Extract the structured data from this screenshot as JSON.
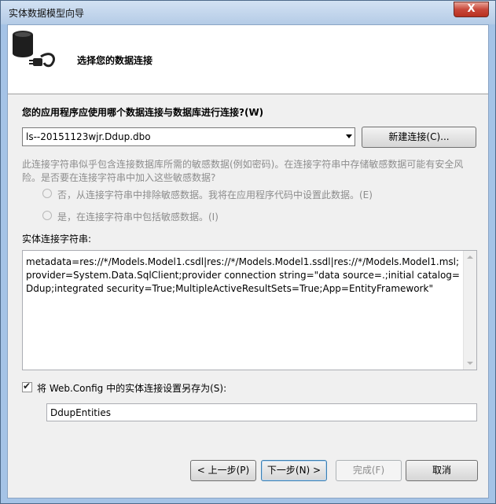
{
  "window": {
    "title": "实体数据模型向导",
    "close_glyph": "X"
  },
  "header": {
    "title": "选择您的数据连接",
    "icon": "database-plug-icon"
  },
  "question": "您的应用程序应使用哪个数据连接与数据库进行连接?(W)",
  "connection": {
    "selected": "ls--20151123wjr.Ddup.dbo",
    "new_button": "新建连接(C)..."
  },
  "sensitive": {
    "line1": "此连接字符串似乎包含连接数据库所需的敏感数据(例如密码)。在连接字符串中存储敏感数据可能有安全风",
    "line2": "险。是否要在连接字符串中加入这些敏感数据?",
    "option_no": "否，从连接字符串中排除敏感数据。我将在应用程序代码中设置此数据。(E)",
    "option_yes": "是，在连接字符串中包括敏感数据。(I)"
  },
  "entity_string": {
    "label": "实体连接字符串:",
    "value": "metadata=res://*/Models.Model1.csdl|res://*/Models.Model1.ssdl|res://*/Models.Model1.msl;provider=System.Data.SqlClient;provider connection string=\"data source=.;initial catalog=Ddup;integrated security=True;MultipleActiveResultSets=True;App=EntityFramework\""
  },
  "save": {
    "checked": true,
    "label": "将 Web.Config 中的实体连接设置另存为(S):",
    "value": "DdupEntities"
  },
  "buttons": {
    "back": "< 上一步(P)",
    "next": "下一步(N) >",
    "finish": "完成(F)",
    "cancel": "取消"
  },
  "colors": {
    "frame": "#a5c3e6",
    "close": "#c8483a",
    "disabled_text": "#8d8d8d"
  }
}
